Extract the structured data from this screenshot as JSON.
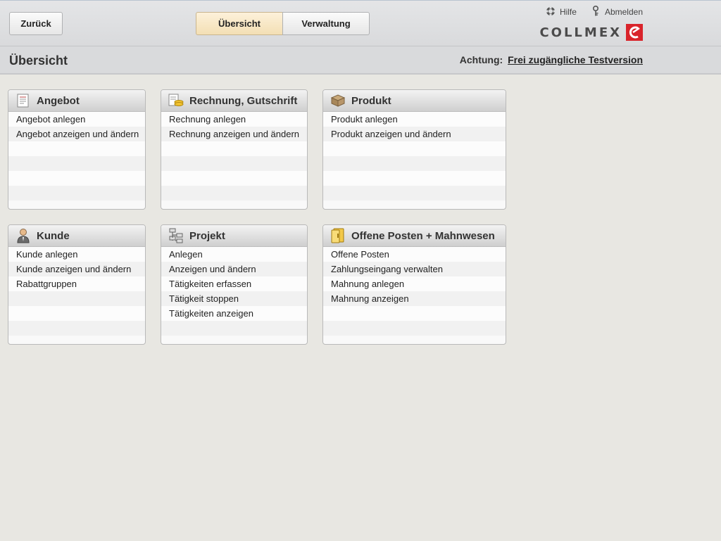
{
  "header": {
    "back_label": "Zurück",
    "tabs": [
      {
        "label": "Übersicht",
        "active": true
      },
      {
        "label": "Verwaltung",
        "active": false
      }
    ],
    "links": {
      "help": "Hilfe",
      "logout": "Abmelden"
    },
    "logo_text": "COLLMEX"
  },
  "subheader": {
    "title": "Übersicht",
    "notice_label": "Achtung:",
    "notice_link": "Frei zugängliche Testversion"
  },
  "panels": [
    {
      "title": "Angebot",
      "icon": "document-icon",
      "items": [
        "Angebot anlegen",
        "Angebot anzeigen und ändern"
      ]
    },
    {
      "title": "Rechnung, Gutschrift",
      "icon": "invoice-coins-icon",
      "items": [
        "Rechnung anlegen",
        "Rechnung anzeigen und ändern"
      ]
    },
    {
      "title": "Produkt",
      "icon": "box-icon",
      "items": [
        "Produkt anlegen",
        "Produkt anzeigen und ändern"
      ]
    },
    {
      "title": "Kunde",
      "icon": "person-icon",
      "items": [
        "Kunde anlegen",
        "Kunde anzeigen und ändern",
        "Rabattgruppen"
      ]
    },
    {
      "title": "Projekt",
      "icon": "project-tree-icon",
      "items": [
        "Anlegen",
        "Anzeigen und ändern",
        "Tätigkeiten erfassen",
        "Tätigkeit stoppen",
        "Tätigkeiten anzeigen"
      ]
    },
    {
      "title": "Offene Posten + Mahnwesen",
      "icon": "folder-icon",
      "items": [
        "Offene Posten",
        "Zahlungseingang verwalten",
        "Mahnung anlegen",
        "Mahnung anzeigen"
      ]
    }
  ],
  "colors": {
    "active_tab": "#f3dfb4",
    "logo_red": "#d9242b",
    "background": "#e8e7e2"
  }
}
